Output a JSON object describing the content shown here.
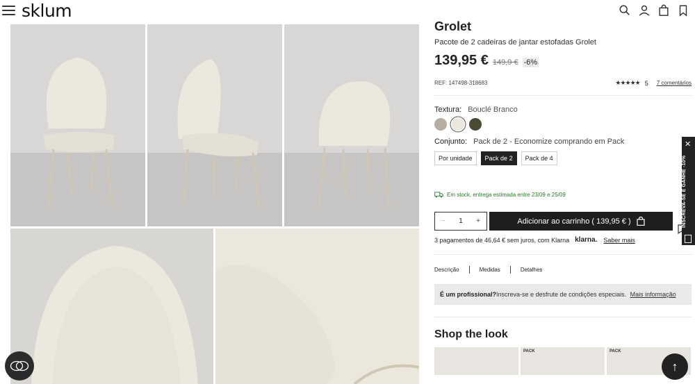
{
  "header": {
    "logo": "sklum",
    "icons": [
      "menu-icon",
      "search-icon",
      "user-icon",
      "bag-icon",
      "bookmark-icon"
    ]
  },
  "product": {
    "title": "Grolet",
    "subtitle": "Pacote de 2 cadeiras de jantar estofadas Grolet",
    "price": "139,95 €",
    "old_price": "149,9 €",
    "discount": "-6%",
    "ref": "REF: 147498-318683",
    "rating_value": "5",
    "reviews": "7 comentários",
    "texture_label": "Textura:",
    "texture_value": "Bouclé Branco",
    "swatches": [
      {
        "name": "taupe",
        "color": "#b7ada0"
      },
      {
        "name": "boucle-white",
        "color": "#ece8de"
      },
      {
        "name": "olive",
        "color": "#4a4a35"
      }
    ],
    "set_label": "Conjunto:",
    "set_value": "Pack de 2 - Economize comprando em Pack",
    "packs": [
      "Por unidade",
      "Pack de 2",
      "Pack de 4"
    ],
    "stock_text": "Em stock, entrega estimada entre 23/09 e 25/09",
    "qty_minus": "−",
    "qty": "1",
    "qty_plus": "+",
    "add_to_cart": "Adicionar ao carrinho ( 139,95 € )",
    "klarna_text": "3 pagamentos de 46,64 € sem juros, com Klarna",
    "klarna_logo": "klarna.",
    "klarna_more": "Saber mais",
    "tabs": [
      "Descrição",
      "Medidas",
      "Detalhes"
    ],
    "pro_bold": "É um profissional?",
    "pro_text": "Inscreva-se e desfrute de condições especiais.",
    "pro_more": "Mais informação",
    "shop_the_look": "Shop the look",
    "look_badges": [
      "",
      "PACK",
      "PACK"
    ]
  },
  "side_banner": {
    "close": "✕",
    "text": "INSCREVA-SE E GANHE -10%"
  },
  "floating": {
    "scroll_top": "↑"
  },
  "colors": {
    "accent": "#1e1e1e",
    "stock_green": "#2a7a2a",
    "chair_fabric": "#ece8de",
    "floor": "#cfcdcb"
  }
}
